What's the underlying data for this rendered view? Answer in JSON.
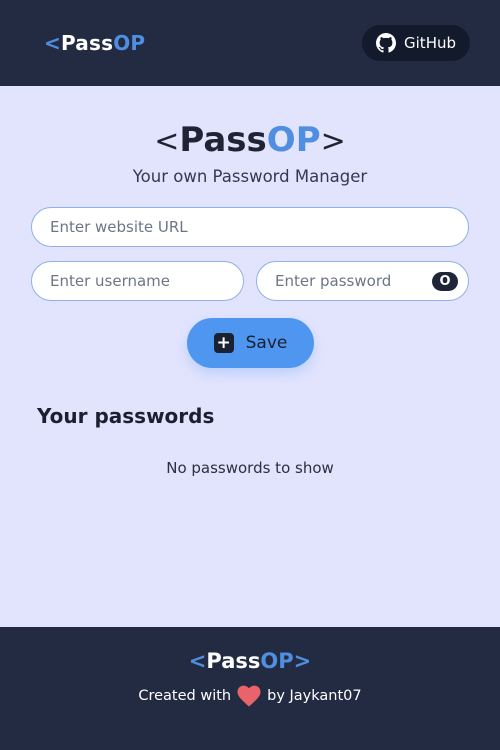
{
  "brand": {
    "open_bracket": "<",
    "pass": "Pass",
    "op": "OP",
    "close_bracket": ">"
  },
  "navbar": {
    "github_label": "GitHub",
    "github_icon": "github-icon"
  },
  "main": {
    "tagline": "Your own Password Manager",
    "url_placeholder": "Enter website URL",
    "username_placeholder": "Enter username",
    "password_placeholder": "Enter password",
    "show_password_glyph": "O",
    "save_label": "Save",
    "save_icon": "plus-icon",
    "section_title": "Your passwords",
    "empty_message": "No passwords to show"
  },
  "footer": {
    "created_with": "Created with",
    "by_author": "by Jaykant07",
    "heart_icon": "heart-icon"
  },
  "colors": {
    "nav_bg": "#232b43",
    "page_bg": "#e2e4fe",
    "accent": "#4f8ee0",
    "save_button": "#4f96f0",
    "heart": "#e8646a"
  }
}
